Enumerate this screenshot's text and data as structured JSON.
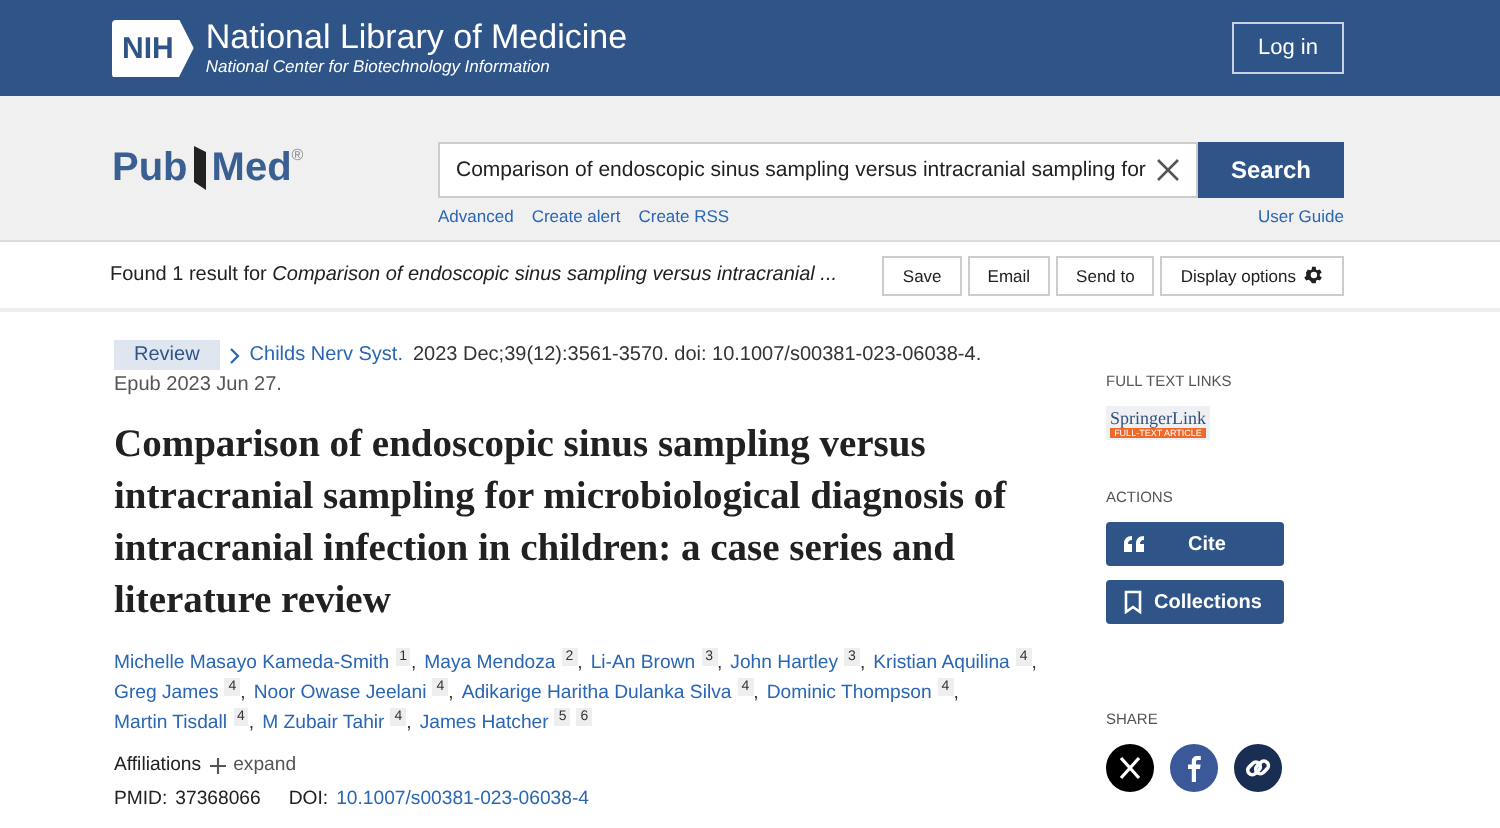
{
  "header": {
    "org_badge": "NIH",
    "org_title": "National Library of Medicine",
    "org_subtitle": "National Center for Biotechnology Information",
    "login_button": "Log in"
  },
  "search": {
    "logo_left": "Pub",
    "logo_right": "Med",
    "logo_mark": "®",
    "value": "Comparison of endoscopic sinus sampling versus intracranial sampling for",
    "button": "Search",
    "links": [
      "Advanced",
      "Create alert",
      "Create RSS"
    ],
    "user_guide": "User Guide"
  },
  "results_bar": {
    "prefix": "Found 1 result for",
    "query": "Comparison of endoscopic sinus sampling versus intracranial ...",
    "buttons": [
      {
        "label": "Save",
        "kind": "plain"
      },
      {
        "label": "Email",
        "kind": "plain"
      },
      {
        "label": "Send to",
        "kind": "plain"
      },
      {
        "label": "Display options",
        "kind": "gear"
      }
    ]
  },
  "article": {
    "type": "Review",
    "journal": "Childs Nerv Syst.",
    "citation": "2023 Dec;39(12):3561-3570. doi: 10.1007/s00381-023-06038-4.",
    "epub": "Epub 2023 Jun 27.",
    "title": "Comparison of endoscopic sinus sampling versus intracranial sampling for microbiological diagnosis of intracranial infection in children: a case series and literature review",
    "authors": [
      {
        "name": "Michelle Masayo Kameda-Smith",
        "affils": [
          "1"
        ],
        "sep": ","
      },
      {
        "name": "Maya Mendoza",
        "affils": [
          "2"
        ],
        "sep": ","
      },
      {
        "name": "Li-An Brown",
        "affils": [
          "3"
        ],
        "sep": ","
      },
      {
        "name": "John Hartley",
        "affils": [
          "3"
        ],
        "sep": ","
      },
      {
        "name": "Kristian Aquilina",
        "affils": [
          "4"
        ],
        "sep": ","
      },
      {
        "name": "Greg James",
        "affils": [
          "4"
        ],
        "sep": ","
      },
      {
        "name": "Noor Owase Jeelani",
        "affils": [
          "4"
        ],
        "sep": ","
      },
      {
        "name": "Adikarige Haritha Dulanka Silva",
        "affils": [
          "4"
        ],
        "sep": ","
      },
      {
        "name": "Dominic Thompson",
        "affils": [
          "4"
        ],
        "sep": ","
      },
      {
        "name": "Martin Tisdall",
        "affils": [
          "4"
        ],
        "sep": ","
      },
      {
        "name": "M Zubair Tahir",
        "affils": [
          "4"
        ],
        "sep": ","
      },
      {
        "name": "James Hatcher",
        "affils": [
          "5",
          "6"
        ]
      }
    ],
    "affiliations_label": "Affiliations",
    "expand": "expand",
    "pmid_label": "PMID:",
    "pmid": "37368066",
    "doi_label": "DOI:",
    "doi": "10.1007/s00381-023-06038-4"
  },
  "sidebar": {
    "full_text_heading": "FULL TEXT LINKS",
    "springer_name": "SpringerLink",
    "springer_tag": "FULL-TEXT ARTICLE",
    "actions_heading": "ACTIONS",
    "actions": [
      {
        "label": "Cite",
        "kind": "cite"
      },
      {
        "label": "Collections",
        "kind": "collections"
      }
    ],
    "share_heading": "SHARE",
    "share": [
      {
        "kind": "x"
      },
      {
        "kind": "facebook"
      },
      {
        "kind": "link"
      }
    ]
  }
}
